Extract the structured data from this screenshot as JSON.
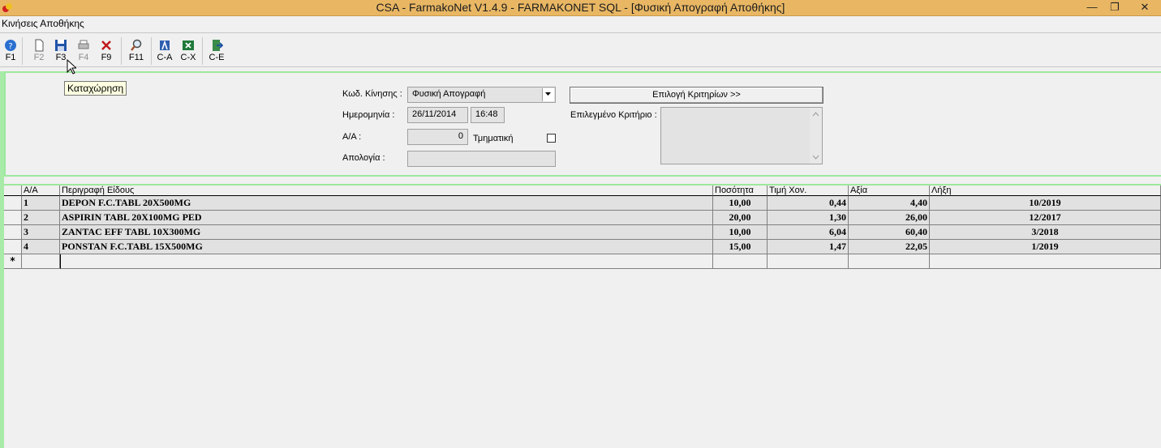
{
  "window": {
    "title": "CSA - FarmakoNet V1.4.9 - FARMAKONET SQL - [Φυσική Απογραφή Αποθήκης]",
    "minimize": "—",
    "restore": "❐",
    "close": "✕"
  },
  "menu": {
    "item": "Κινήσεις Αποθήκης"
  },
  "toolbar": [
    {
      "label": "F1",
      "icon": "help-icon",
      "enabled": true
    },
    {
      "label": "F2",
      "icon": "new-document-icon",
      "enabled": false
    },
    {
      "label": "F3",
      "icon": "save-icon",
      "enabled": true
    },
    {
      "label": "F4",
      "icon": "print-icon",
      "enabled": false
    },
    {
      "label": "F9",
      "icon": "delete-icon",
      "enabled": true
    },
    {
      "label": "F11",
      "icon": "search-icon",
      "enabled": true
    },
    {
      "label": "C-A",
      "icon": "access-icon",
      "enabled": true
    },
    {
      "label": "C-X",
      "icon": "excel-icon",
      "enabled": true
    },
    {
      "label": "C-E",
      "icon": "exit-icon",
      "enabled": true
    }
  ],
  "tooltip": "Καταχώρηση",
  "form": {
    "code_label": "Κωδ. Κίνησης :",
    "code_value": "Φυσική Απογραφή",
    "date_label": "Ημερομηνία :",
    "date_value": "26/11/2014",
    "time_value": "16:48",
    "aa_label": "Α/Α :",
    "aa_value": "0",
    "partial_label": "Τμηματική",
    "reason_label": "Απολογία :",
    "reason_value": "",
    "criteria_button": "Επιλογή Κριτηρίων >>",
    "selected_criteria_label": "Επιλεγμένο Κριτήριο :"
  },
  "grid": {
    "columns": [
      "Α/Α",
      "Περιγραφή Είδους",
      "Ποσότητα",
      "Τιμή Χον.",
      "Αξία",
      "Λήξη"
    ],
    "rows": [
      [
        "1",
        "DEPON F.C.TABL 20X500MG",
        "10,00",
        "0,44",
        "4,40",
        "10/2019"
      ],
      [
        "2",
        "ASPIRIN TABL 20X100MG PED",
        "20,00",
        "1,30",
        "26,00",
        "12/2017"
      ],
      [
        "3",
        "ZANTAC EFF TABL 10X300MG",
        "10,00",
        "6,04",
        "60,40",
        "3/2018"
      ],
      [
        "4",
        "PONSTAN F.C.TABL 15X500MG",
        "15,00",
        "1,47",
        "22,05",
        "1/2019"
      ]
    ],
    "new_row_marker": "*"
  }
}
